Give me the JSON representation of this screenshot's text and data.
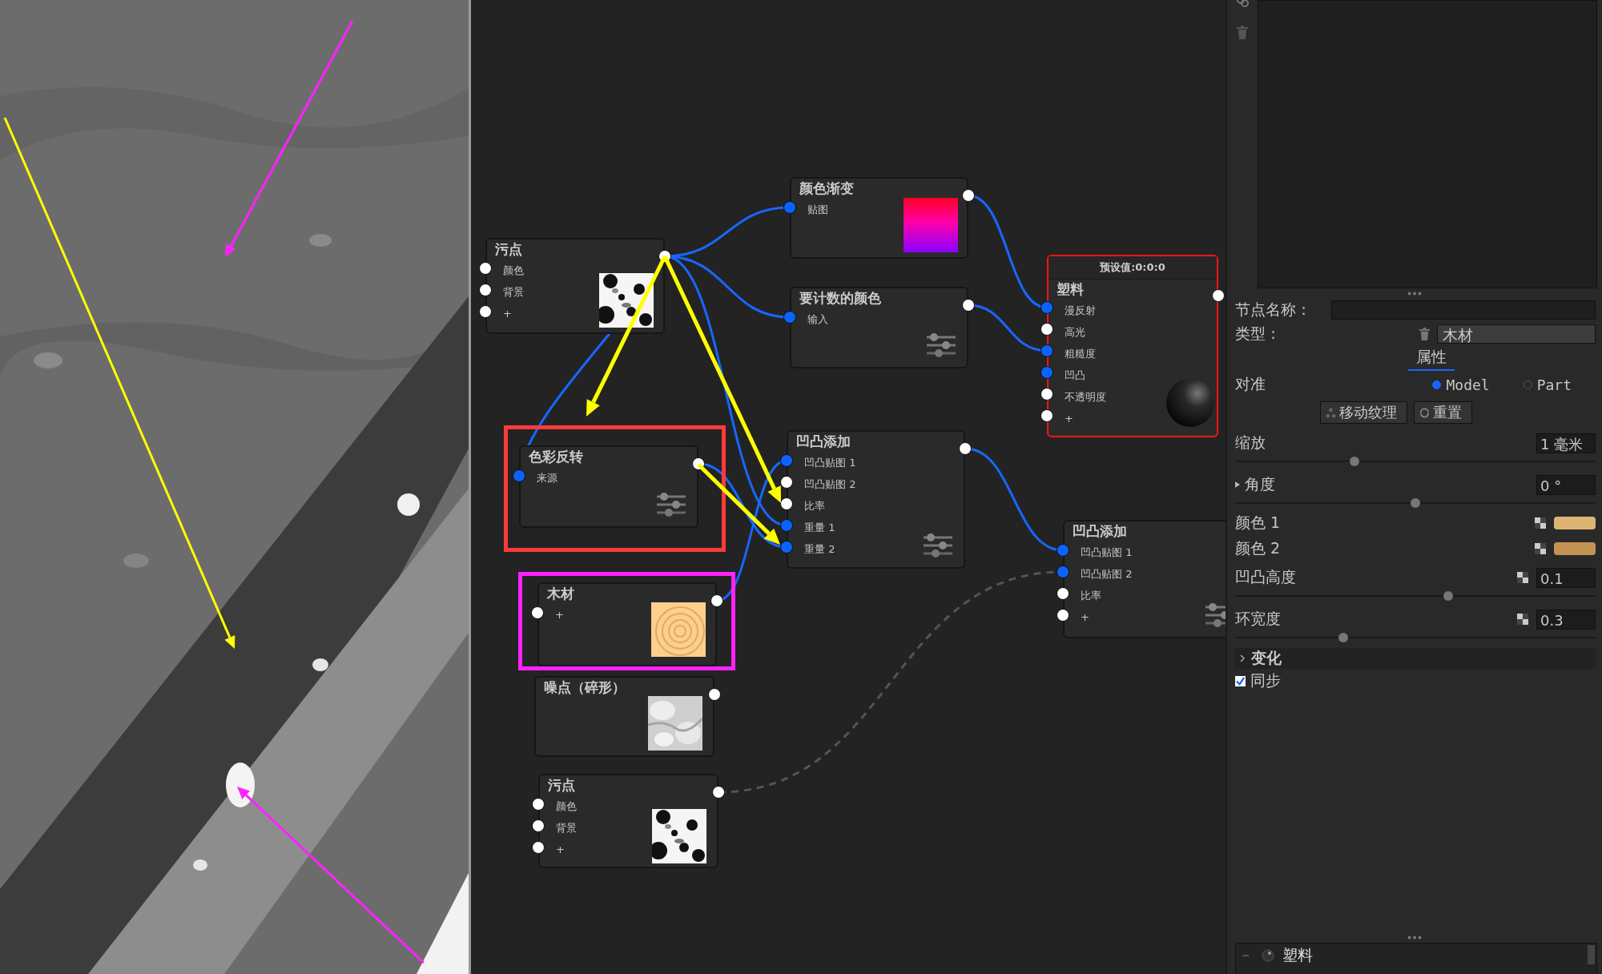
{
  "nodes": [
    {
      "title": "污点",
      "ports": [
        {
          "label": "颜色",
          "connected": false
        },
        {
          "label": "背景",
          "connected": false
        },
        {
          "label": "+",
          "connected": false
        }
      ],
      "kind": "spots",
      "selected": false
    },
    {
      "title": "色彩反转",
      "ports": [
        {
          "label": "来源",
          "connected": true
        }
      ],
      "kind": "sliders",
      "selected": false
    },
    {
      "title": "木材",
      "ports": [
        {
          "label": "+",
          "connected": false
        }
      ],
      "kind": "wood",
      "selected": false
    },
    {
      "title": "噪点（碎形）",
      "kind": "fractal",
      "selected": false
    },
    {
      "title": "污点",
      "ports": [
        {
          "label": "颜色",
          "connected": false
        },
        {
          "label": "背景",
          "connected": false
        },
        {
          "label": "+",
          "connected": false
        }
      ],
      "kind": "spots",
      "selected": false
    },
    {
      "title": "颜色渐变",
      "ports": [
        {
          "label": "贴图",
          "connected": true
        }
      ],
      "kind": "gradient",
      "selected": false
    },
    {
      "title": "要计数的颜色",
      "ports": [
        {
          "label": "输入",
          "connected": true
        }
      ],
      "kind": "sliders",
      "selected": false
    },
    {
      "title": "凹凸添加",
      "ports": [
        {
          "label": "凹凸贴图 1",
          "connected": true
        },
        {
          "label": "凹凸贴图 2",
          "connected": false
        },
        {
          "label": "比率",
          "connected": false
        },
        {
          "label": "重量 1",
          "connected": true
        },
        {
          "label": "重量 2",
          "connected": true
        }
      ],
      "kind": "sliders",
      "selected": false
    },
    {
      "header": "预设值:0:0:0",
      "title": "塑料",
      "ports": [
        {
          "label": "漫反射",
          "connected": true
        },
        {
          "label": "高光",
          "connected": false
        },
        {
          "label": "粗糙度",
          "connected": true
        },
        {
          "label": "凹凸",
          "connected": true
        },
        {
          "label": "不透明度",
          "connected": false
        },
        {
          "label": "+",
          "connected": false
        }
      ],
      "kind": "sphere",
      "selected": true
    },
    {
      "title": "凹凸添加",
      "ports": [
        {
          "label": "凹凸贴图 1",
          "connected": true
        },
        {
          "label": "凹凸贴图 2",
          "connected": true
        },
        {
          "label": "比率",
          "connected": false
        },
        {
          "label": "+",
          "connected": false
        }
      ],
      "kind": "sliders",
      "selected": false
    }
  ],
  "panel": {
    "node_name_label": "节点名称：",
    "type_label": "类型：",
    "type_value": "木材",
    "section_tab": "属性",
    "align": {
      "label": "对准",
      "options": [
        {
          "label": "Model",
          "selected": true
        },
        {
          "label": "Part",
          "selected": false
        }
      ]
    },
    "buttons": [
      {
        "label": "移动纹理",
        "kind": "move"
      },
      {
        "label": "重置",
        "kind": "reset"
      }
    ],
    "properties": [
      {
        "kind": "slider",
        "label": "缩放",
        "value": "1 毫米",
        "level": 0.33
      },
      {
        "kind": "slider",
        "label": "角度",
        "value": "0 °",
        "level": 0.5,
        "expanded": false
      },
      {
        "kind": "color",
        "label": "颜色 1",
        "color": "#dcb574"
      },
      {
        "kind": "color",
        "label": "颜色 2",
        "color": "#c49352"
      },
      {
        "kind": "mapped_slider",
        "label": "凹凸高度",
        "value": "0.1",
        "level": 0.59
      },
      {
        "kind": "mapped_slider",
        "label": "环宽度",
        "value": "0.3",
        "level": 0.3
      }
    ],
    "group": {
      "label": "变化",
      "expanded": false
    },
    "sync": {
      "label": "同步",
      "checked": true
    },
    "tree": [
      {
        "label": "塑料",
        "expanded": true
      }
    ]
  }
}
